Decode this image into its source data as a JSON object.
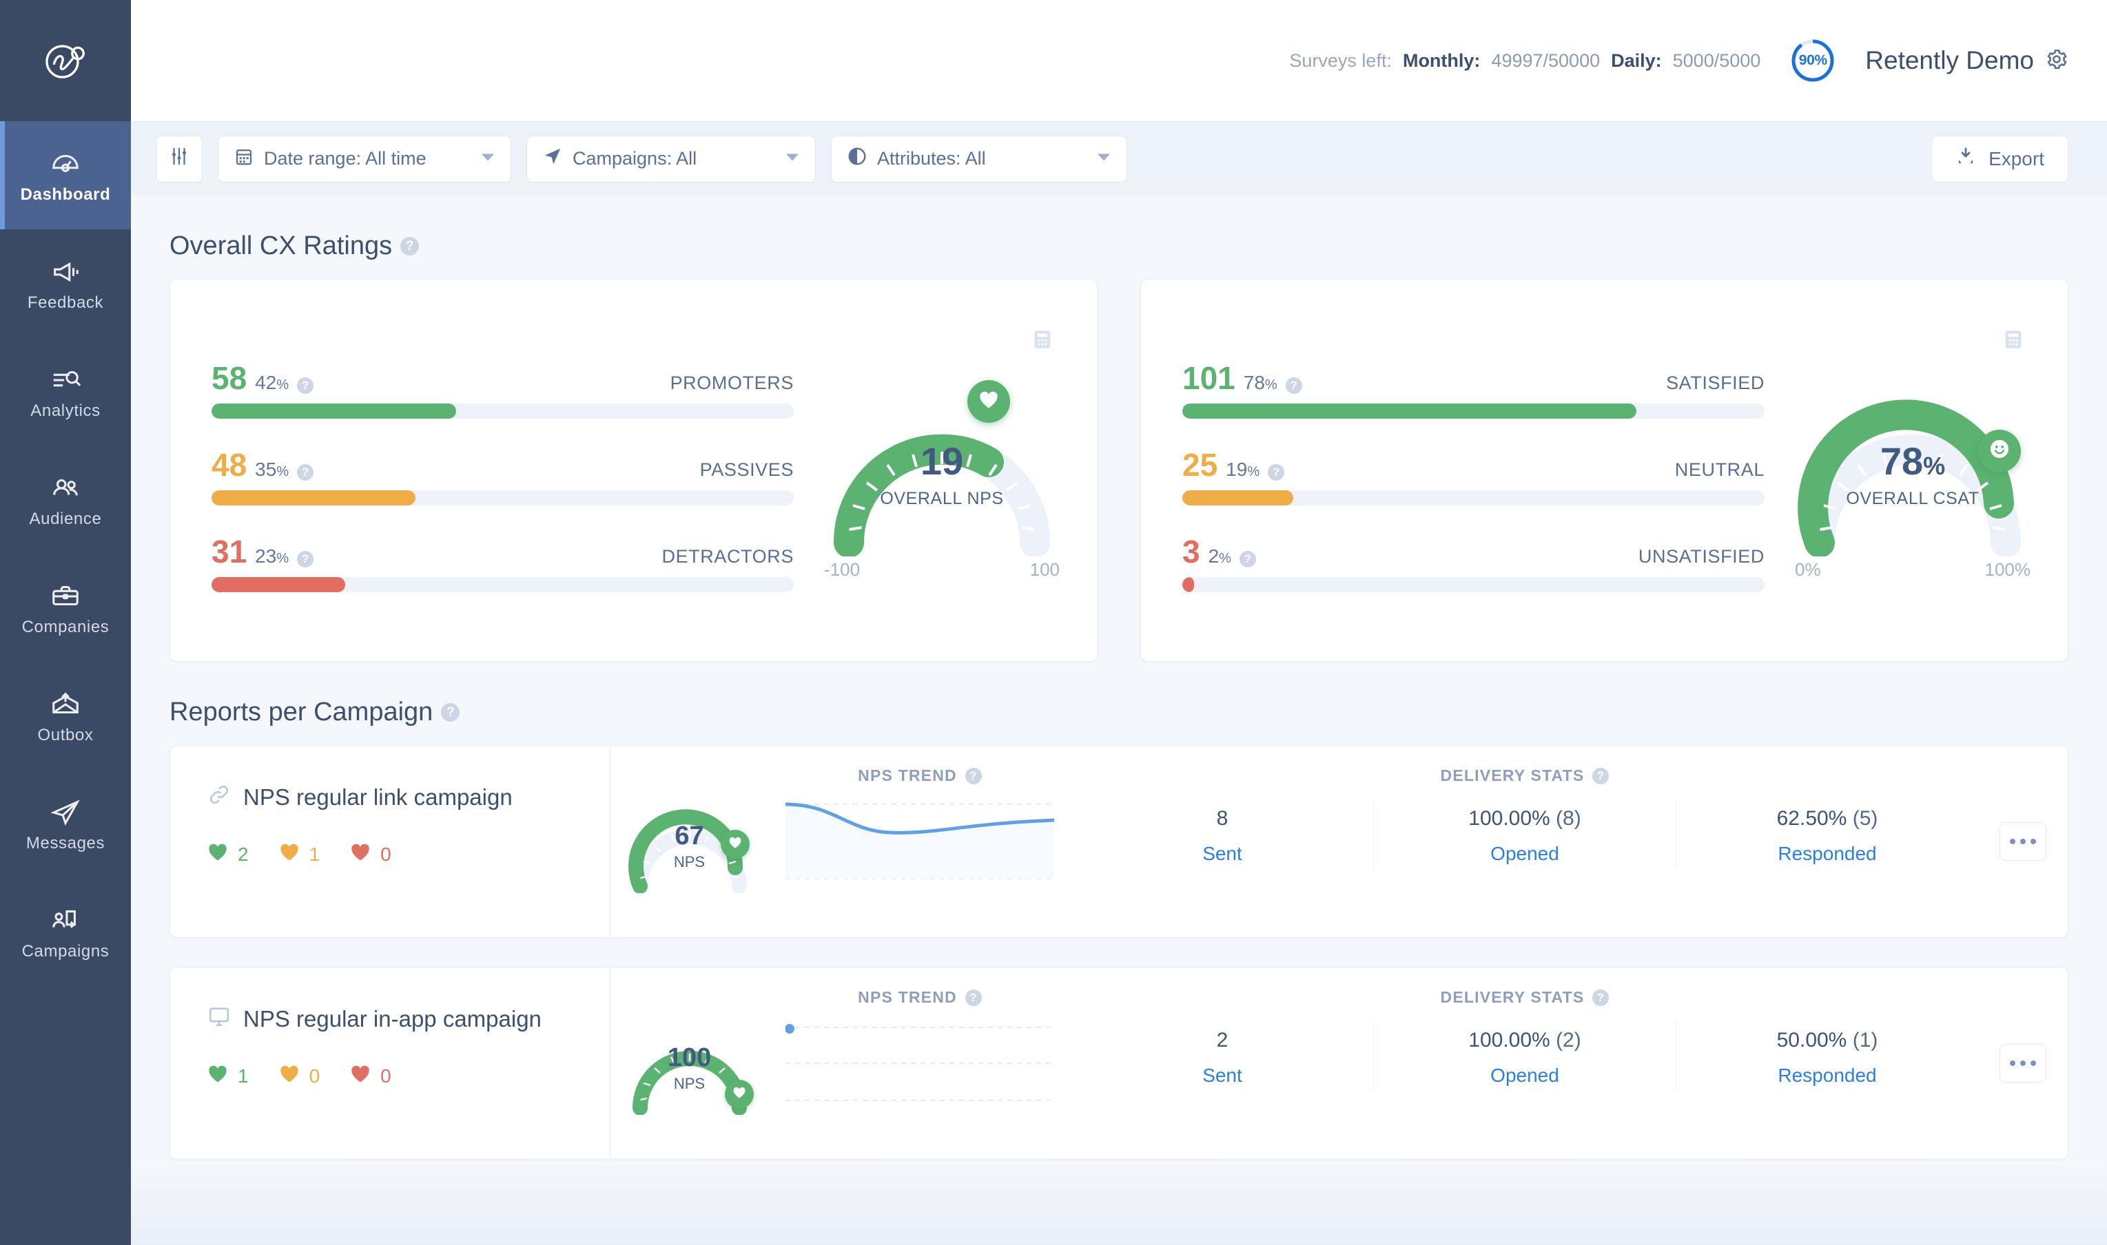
{
  "brand": {
    "logo_name": "retently-logo"
  },
  "sidebar": {
    "items": [
      {
        "label": "Dashboard",
        "icon": "gauge-icon",
        "active": true
      },
      {
        "label": "Feedback",
        "icon": "megaphone-icon",
        "active": false
      },
      {
        "label": "Analytics",
        "icon": "list-search-icon",
        "active": false
      },
      {
        "label": "Audience",
        "icon": "people-icon",
        "active": false
      },
      {
        "label": "Companies",
        "icon": "briefcase-icon",
        "active": false
      },
      {
        "label": "Outbox",
        "icon": "outbox-envelope-icon",
        "active": false
      },
      {
        "label": "Messages",
        "icon": "paper-plane-icon",
        "active": false
      },
      {
        "label": "Campaigns",
        "icon": "campaign-user-icon",
        "active": false
      }
    ]
  },
  "header": {
    "surveys_left_label": "Surveys left:",
    "monthly_label": "Monthly:",
    "monthly_value": "49997/50000",
    "daily_label": "Daily:",
    "daily_value": "5000/5000",
    "quota_percent": "90%",
    "quota_percent_value": 90,
    "account_name": "Retently Demo",
    "settings_icon": "gear-icon"
  },
  "filters": {
    "toggle_icon": "sliders-icon",
    "date_range": {
      "label": "Date range: All time",
      "icon": "calendar-icon"
    },
    "campaigns": {
      "label": "Campaigns: All",
      "icon": "paper-plane-icon"
    },
    "attributes": {
      "label": "Attributes: All",
      "icon": "pie-icon"
    },
    "export": {
      "label": "Export",
      "icon": "download-icon"
    }
  },
  "cx": {
    "title": "Overall CX Ratings",
    "nps": {
      "bars": [
        {
          "count": "58",
          "pct": "42",
          "pct_symbol": "%",
          "label": "PROMOTERS",
          "color": "#5cb270",
          "fill": 42
        },
        {
          "count": "48",
          "pct": "35",
          "pct_symbol": "%",
          "label": "PASSIVES",
          "color": "#efad47",
          "fill": 35
        },
        {
          "count": "31",
          "pct": "23",
          "pct_symbol": "%",
          "label": "DETRACTORS",
          "color": "#e06e61",
          "fill": 23
        }
      ],
      "gauge_value": "19",
      "gauge_caption": "OVERALL NPS",
      "scale_min": "-100",
      "scale_max": "100",
      "knob_icon": "heart-icon",
      "calculator_icon": "calculator-icon"
    },
    "csat": {
      "bars": [
        {
          "count": "101",
          "pct": "78",
          "pct_symbol": "%",
          "label": "SATISFIED",
          "color": "#5cb270",
          "fill": 78
        },
        {
          "count": "25",
          "pct": "19",
          "pct_symbol": "%",
          "label": "NEUTRAL",
          "color": "#efad47",
          "fill": 19
        },
        {
          "count": "3",
          "pct": "2",
          "pct_symbol": "%",
          "label": "UNSATISFIED",
          "color": "#e06e61",
          "fill": 2
        }
      ],
      "gauge_value": "78",
      "gauge_suffix": "%",
      "gauge_caption": "OVERALL CSAT",
      "scale_min": "0%",
      "scale_max": "100%",
      "knob_icon": "smiley-icon",
      "calculator_icon": "calculator-icon"
    }
  },
  "reports": {
    "title": "Reports per Campaign",
    "nps_trend_label": "NPS TREND",
    "delivery_stats_label": "DELIVERY STATS",
    "campaigns": [
      {
        "name": "NPS regular link campaign",
        "type_icon": "link-icon",
        "hearts": [
          {
            "color": "#5cb270",
            "value": "2"
          },
          {
            "color": "#efad47",
            "value": "1"
          },
          {
            "color": "#e06e61",
            "value": "0"
          }
        ],
        "nps_value": "67",
        "nps_caption": "NPS",
        "sent_value": "8",
        "sent_label": "Sent",
        "opened_value": "100.00%",
        "opened_count": "(8)",
        "opened_label": "Opened",
        "responded_value": "62.50%",
        "responded_count": "(5)",
        "responded_label": "Responded",
        "trend_type": "line"
      },
      {
        "name": "NPS regular in-app campaign",
        "type_icon": "monitor-icon",
        "hearts": [
          {
            "color": "#5cb270",
            "value": "1"
          },
          {
            "color": "#efad47",
            "value": "0"
          },
          {
            "color": "#e06e61",
            "value": "0"
          }
        ],
        "nps_value": "100",
        "nps_caption": "NPS",
        "sent_value": "2",
        "sent_label": "Sent",
        "opened_value": "100.00%",
        "opened_count": "(2)",
        "opened_label": "Opened",
        "responded_value": "50.00%",
        "responded_count": "(1)",
        "responded_label": "Responded",
        "trend_type": "point"
      }
    ],
    "more_icon": "ellipsis-icon"
  },
  "chart_data": [
    {
      "type": "bar",
      "title": "Overall NPS breakdown",
      "categories": [
        "PROMOTERS",
        "PASSIVES",
        "DETRACTORS"
      ],
      "values": [
        42,
        35,
        23
      ],
      "counts": [
        58,
        48,
        31
      ],
      "ylabel": "percent",
      "ylim": [
        0,
        100
      ]
    },
    {
      "type": "bar",
      "title": "Overall CSAT breakdown",
      "categories": [
        "SATISFIED",
        "NEUTRAL",
        "UNSATISFIED"
      ],
      "values": [
        78,
        19,
        2
      ],
      "counts": [
        101,
        25,
        3
      ],
      "ylabel": "percent",
      "ylim": [
        0,
        100
      ]
    },
    {
      "type": "gauge",
      "title": "OVERALL NPS",
      "value": 19,
      "min": -100,
      "max": 100
    },
    {
      "type": "gauge",
      "title": "OVERALL CSAT",
      "value": 78,
      "min": 0,
      "max": 100
    },
    {
      "type": "line",
      "title": "NPS TREND — NPS regular link campaign",
      "x": [
        0,
        1,
        2,
        3,
        4
      ],
      "values": [
        100,
        78,
        62,
        60,
        72
      ],
      "ylim": [
        -100,
        100
      ],
      "grid": true
    },
    {
      "type": "scatter",
      "title": "NPS TREND — NPS regular in-app campaign",
      "x": [
        0
      ],
      "values": [
        100
      ],
      "ylim": [
        -100,
        100
      ],
      "grid": true
    }
  ]
}
